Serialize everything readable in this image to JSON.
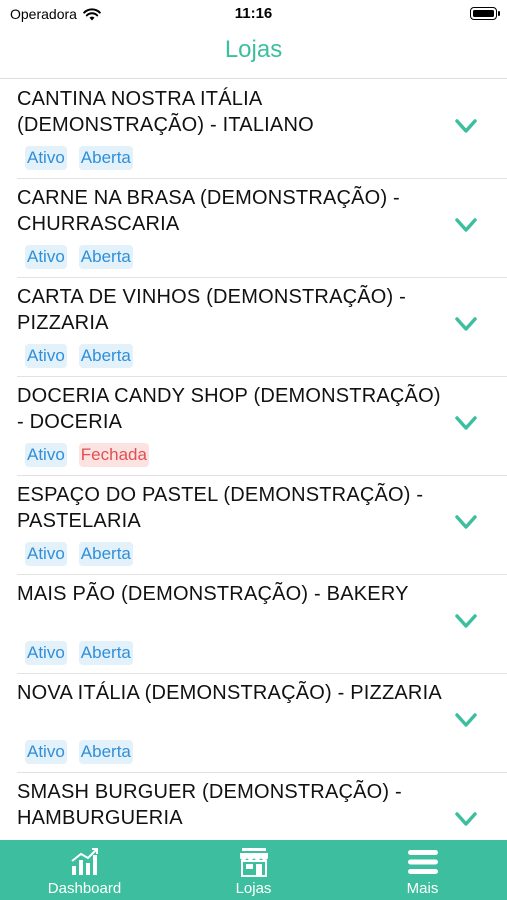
{
  "status": {
    "carrier": "Operadora",
    "time": "11:16"
  },
  "header": {
    "title": "Lojas"
  },
  "stores": [
    {
      "name": "CANTINA NOSTRA ITÁLIA (DEMONSTRAÇÃO) - ITALIANO",
      "status": "Ativo",
      "open": "Aberta"
    },
    {
      "name": "CARNE NA BRASA (DEMONSTRAÇÃO) - CHURRASCARIA",
      "status": "Ativo",
      "open": "Aberta"
    },
    {
      "name": "CARTA DE VINHOS (DEMONSTRAÇÃO) - PIZZARIA",
      "status": "Ativo",
      "open": "Aberta"
    },
    {
      "name": "DOCERIA CANDY SHOP (DEMONSTRAÇÃO) - DOCERIA",
      "status": "Ativo",
      "open": "Fechada"
    },
    {
      "name": "ESPAÇO DO PASTEL (DEMONSTRAÇÃO) - PASTELARIA",
      "status": "Ativo",
      "open": "Aberta"
    },
    {
      "name": "MAIS PÃO (DEMONSTRAÇÃO) - BAKERY",
      "status": "Ativo",
      "open": "Aberta"
    },
    {
      "name": "NOVA ITÁLIA (DEMONSTRAÇÃO) - PIZZARIA",
      "status": "Ativo",
      "open": "Aberta"
    },
    {
      "name": "SMASH BURGUER (DEMONSTRAÇÃO) - HAMBURGUERIA",
      "status": "",
      "open": ""
    }
  ],
  "tabbar": {
    "items": [
      {
        "label": "Dashboard",
        "icon": "chart-icon"
      },
      {
        "label": "Lojas",
        "icon": "store-icon"
      },
      {
        "label": "Mais",
        "icon": "menu-icon"
      }
    ]
  },
  "colors": {
    "accent": "#3dbf9f",
    "badge_blue": "#2f8fd8",
    "badge_red": "#e05050"
  }
}
